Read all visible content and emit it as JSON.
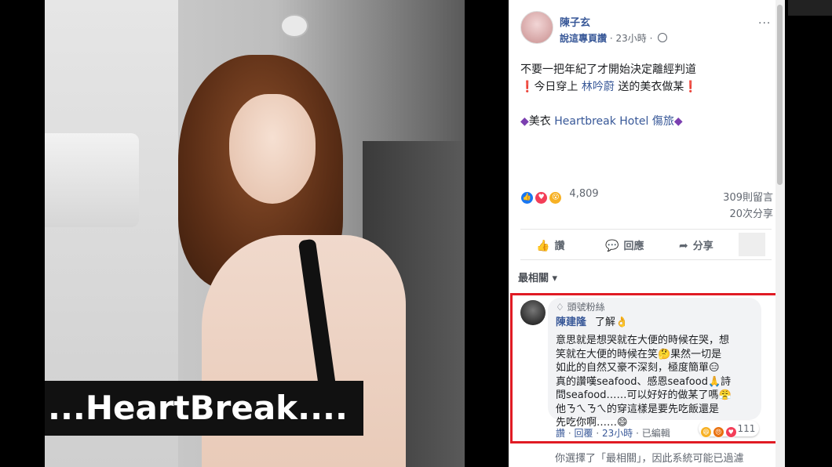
{
  "photo": {
    "caption": "...HeartBreak...."
  },
  "post": {
    "author": "陳子玄",
    "author_role": "說這專頁讚",
    "time": "23小時",
    "lines": [
      "不要一把年紀了才開始決定離經判道",
      "今日穿上",
      "林吟蔚",
      "送的美衣做某"
    ],
    "brand_prefix": "美衣",
    "brand_tag": "Heartbreak Hotel 傷旅",
    "reaction_count": "4,809",
    "comments_count": "309則留言",
    "shares_count": "20次分享"
  },
  "actions": {
    "like": "讚",
    "comment": "回應",
    "share": "分享"
  },
  "sort_label": "最相關 ▾",
  "comment": {
    "badge": "頭號粉絲",
    "author": "陳建隆",
    "first_text": "了解",
    "body_lines": [
      "意思就是想哭就在大便的時候在哭，想",
      "笑就在大便的時候在笑🤔果然一切是",
      "如此的自然又豪不深刻，極度簡單😑",
      "真的讚嘆seafood、感恩seafood🙏詩",
      "問seafood……可以好好的做某了嗎😤",
      "他ㄋㄟㄋㄟ的穿這樣是要先吃飯還是",
      "先吃你啊……😄"
    ],
    "like_label": "讚",
    "reply_label": "回覆",
    "time": "23小時",
    "edited": "已編輯",
    "reaction_count": "111"
  },
  "notice": "你選擇了「最相關」，因此系統可能已過濾"
}
